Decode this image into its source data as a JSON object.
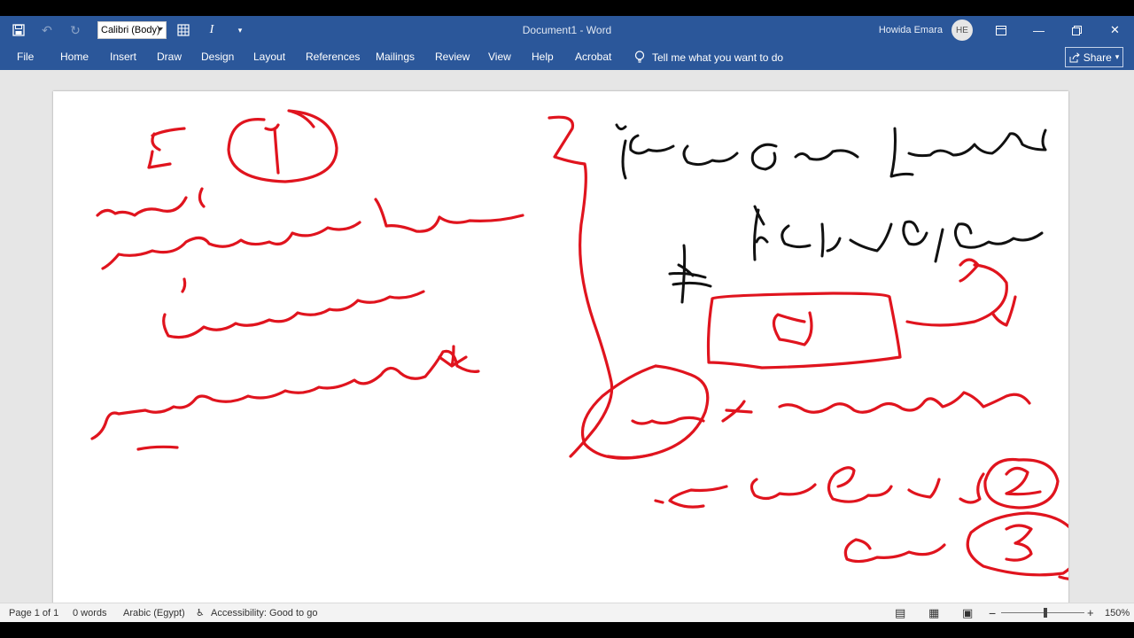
{
  "window": {
    "doc_title": "Document1  -  Word",
    "user_name": "Howida Emara",
    "user_initials": "HE"
  },
  "qat": {
    "font_name": "Calibri (Body)"
  },
  "ribbon": {
    "tabs": [
      "File",
      "Home",
      "Insert",
      "Draw",
      "Design",
      "Layout",
      "References",
      "Mailings",
      "Review",
      "View",
      "Help",
      "Acrobat"
    ],
    "tell_me": "Tell me what you want to do",
    "share_label": "Share"
  },
  "status": {
    "page": "Page 1 of 1",
    "words": "0 words",
    "language": "Arabic (Egypt)",
    "accessibility": "Accessibility: Good to go",
    "zoom": "150%"
  },
  "ink_colors": {
    "red": "#e0141e",
    "black": "#111111"
  }
}
